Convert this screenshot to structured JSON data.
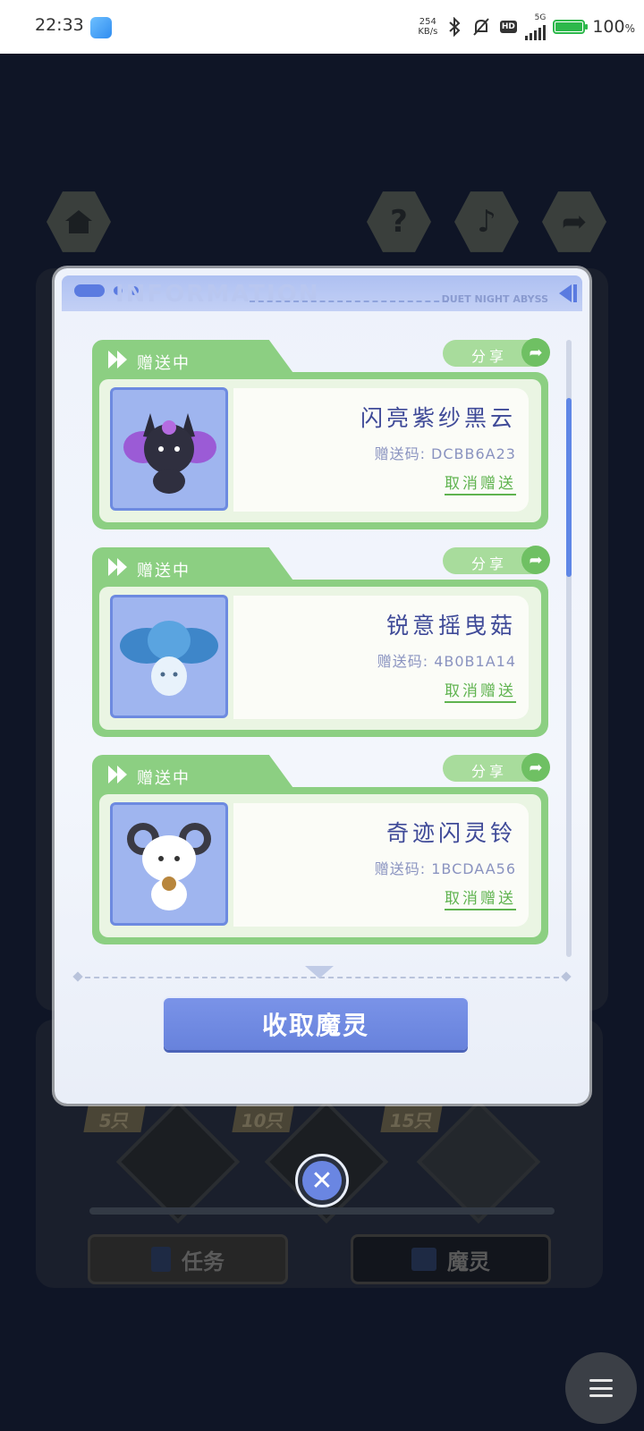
{
  "status_bar": {
    "time": "22:33",
    "net_speed_value": "254",
    "net_speed_unit": "KB/s",
    "network": "5G",
    "hd": "HD",
    "battery": "100",
    "battery_unit": "%",
    "icons": [
      "gallery-icon",
      "bluetooth-icon",
      "mute-bell-icon",
      "hd-icon",
      "signal-icon",
      "battery-charging-icon"
    ]
  },
  "background": {
    "tab_tasks": "任务",
    "tab_spirits": "魔灵",
    "milestones": [
      "5只",
      "10只",
      "15只"
    ]
  },
  "dialog": {
    "header_watermark": "INFORMATION",
    "header_brand": "DUET NIGHT ABYSS",
    "status_label": "赠送中",
    "share_label": "分享",
    "cancel_label": "取消赠送",
    "gifts": [
      {
        "name": "闪亮紫纱黑云",
        "code": "赠送码: DCBB6A23"
      },
      {
        "name": "锐意摇曳菇",
        "code": "赠送码: 4B0B1A14"
      },
      {
        "name": "奇迹闪灵铃",
        "code": "赠送码: 1BCDAA56"
      }
    ],
    "collect_button": "收取魔灵"
  },
  "colors": {
    "accent_blue": "#6782dc",
    "card_green": "#8ccf82",
    "name_text": "#3f4a98",
    "cancel_green": "#5fb34f"
  }
}
